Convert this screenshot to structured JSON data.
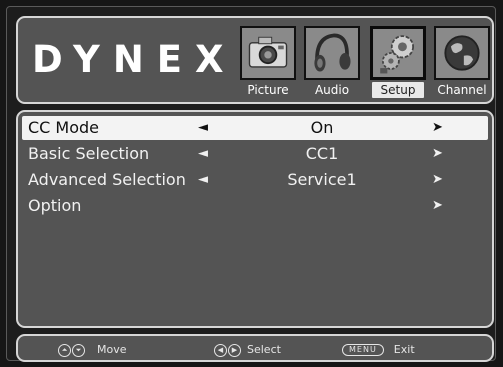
{
  "brand": {
    "logo_text": "DYNEX"
  },
  "tabs": [
    {
      "label": "Picture",
      "icon": "camera-icon",
      "active": false
    },
    {
      "label": "Audio",
      "icon": "headphones-icon",
      "active": false
    },
    {
      "label": "Setup",
      "icon": "gears-icon",
      "active": true
    },
    {
      "label": "Channel",
      "icon": "globe-icon",
      "active": false
    }
  ],
  "menu": {
    "items": [
      {
        "name": "CC Mode",
        "value": "On",
        "left_arrow": "◄",
        "right_arrow": "➤",
        "selected": true
      },
      {
        "name": "Basic Selection",
        "value": "CC1",
        "left_arrow": "◄",
        "right_arrow": "➤",
        "selected": false
      },
      {
        "name": "Advanced Selection",
        "value": "Service1",
        "left_arrow": "◄",
        "right_arrow": "➤",
        "selected": false
      },
      {
        "name": "Option",
        "value": "",
        "left_arrow": "",
        "right_arrow": "➤",
        "selected": false
      }
    ]
  },
  "footer": {
    "move_icons": [
      "⏶",
      "⏷"
    ],
    "move_label": "Move",
    "select_icons": [
      "◀",
      "▶"
    ],
    "select_label": "Select",
    "menu_key": "MENU",
    "exit_label": "Exit"
  },
  "colors": {
    "panel_bg": "#545454",
    "panel_border": "#d6d6d6",
    "selected_row_bg": "#f3f3f3",
    "page_bg": "#161616"
  }
}
